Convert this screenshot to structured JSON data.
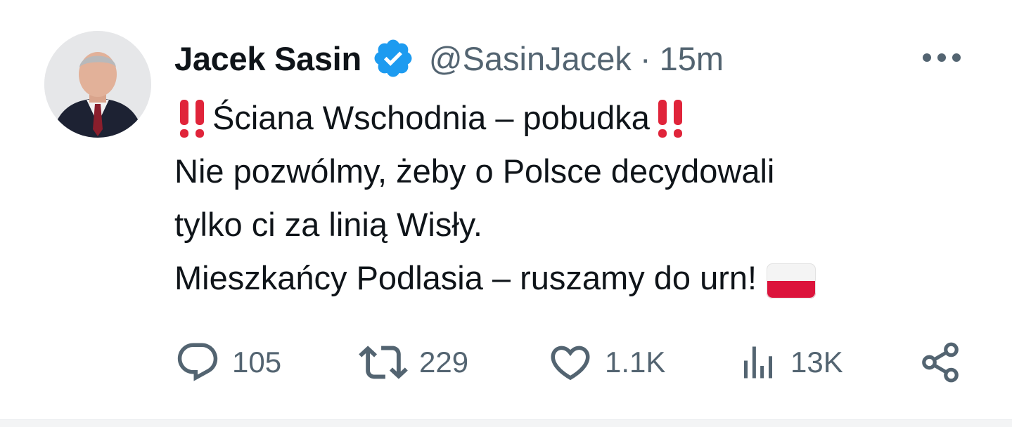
{
  "author": {
    "display_name": "Jacek Sasin",
    "handle": "@SasinJacek",
    "separator": "·",
    "timestamp": "15m",
    "verified_color": "#1d9bf0"
  },
  "tweet": {
    "lines": [
      "Ściana Wschodnia – pobudka",
      "Nie pozwólmy, żeby o Polsce decydowali",
      "tylko ci za linią Wisły.",
      "Mieszkańcy Podlasia – ruszamy do urn!"
    ],
    "emojis": [
      "double-exclamation-icon",
      "poland-flag-icon"
    ]
  },
  "actions": {
    "replies": "105",
    "reposts": "229",
    "likes": "1.1K",
    "views": "13K"
  },
  "colors": {
    "text": "#0f1419",
    "secondary": "#536471",
    "emoji_red": "#e0243a",
    "flag_white": "#f4f4f4",
    "flag_red": "#dc143c"
  }
}
